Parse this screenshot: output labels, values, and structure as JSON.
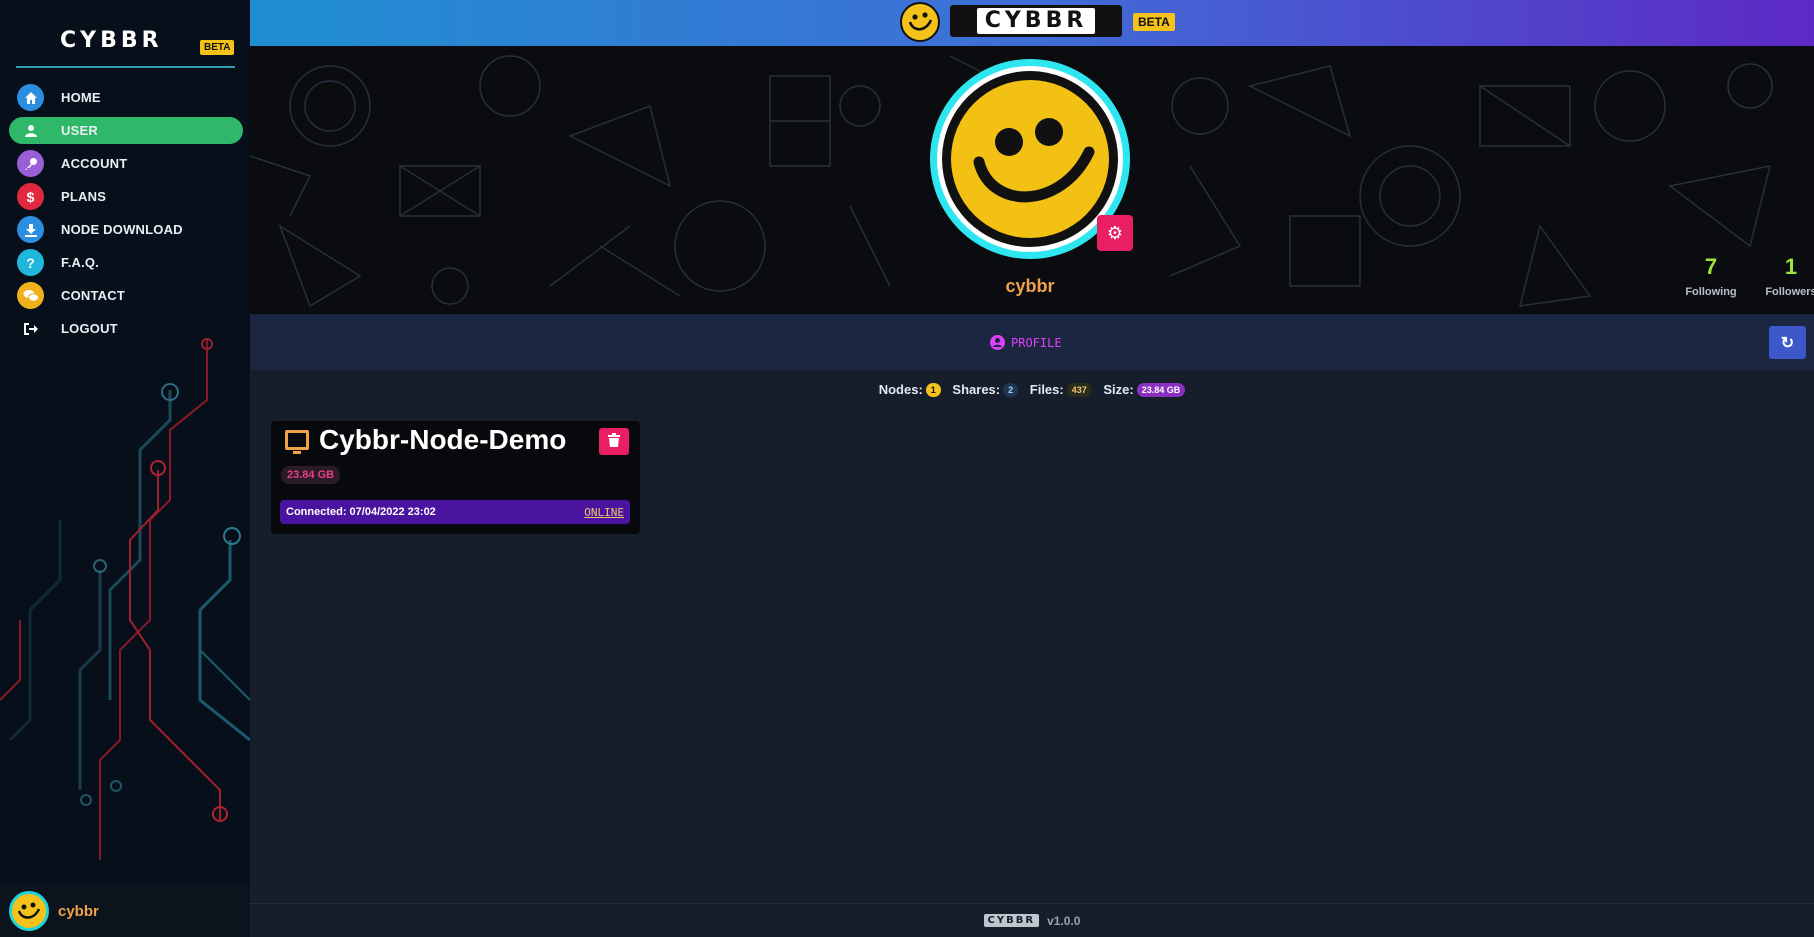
{
  "sidebar": {
    "logo": "CYBBR",
    "beta": "BETA",
    "items": [
      {
        "label": "HOME",
        "icon": "home-icon",
        "color": "#2b8ee0",
        "glyph": "⌂"
      },
      {
        "label": "USER",
        "icon": "user-icon",
        "color": "#2fb86a",
        "glyph": "●"
      },
      {
        "label": "ACCOUNT",
        "icon": "key-icon",
        "color": "#9a5fd6",
        "glyph": "⚷"
      },
      {
        "label": "PLANS",
        "icon": "dollar-icon",
        "color": "#e0283e",
        "glyph": "$"
      },
      {
        "label": "NODE DOWNLOAD",
        "icon": "download-icon",
        "color": "#2b8ee0",
        "glyph": "↓"
      },
      {
        "label": "F.A.Q.",
        "icon": "question-icon",
        "color": "#20b7dc",
        "glyph": "?"
      },
      {
        "label": "CONTACT",
        "icon": "chat-icon",
        "color": "#f0b21a",
        "glyph": "✉"
      },
      {
        "label": "LOGOUT",
        "icon": "logout-icon",
        "color": "transparent",
        "glyph": "⇥"
      }
    ],
    "active_index": 1,
    "username": "cybbr"
  },
  "topbar": {
    "logo": "CYBBR",
    "beta": "BETA"
  },
  "profile": {
    "username": "cybbr",
    "following_count": "7",
    "following_label": "Following",
    "followers_count": "1",
    "followers_label": "Followers"
  },
  "tabs": {
    "profile_label": "PROFILE"
  },
  "stats": {
    "nodes_label": "Nodes:",
    "nodes_value": "1",
    "shares_label": "Shares:",
    "shares_value": "2",
    "files_label": "Files:",
    "files_value": "437",
    "size_label": "Size:",
    "size_value": "23.84 GB"
  },
  "node": {
    "name": "Cybbr-Node-Demo",
    "size": "23.84 GB",
    "connected": "Connected: 07/04/2022 23:02",
    "status": "ONLINE"
  },
  "footer": {
    "logo": "CYBBR",
    "version": "v1.0.0"
  }
}
